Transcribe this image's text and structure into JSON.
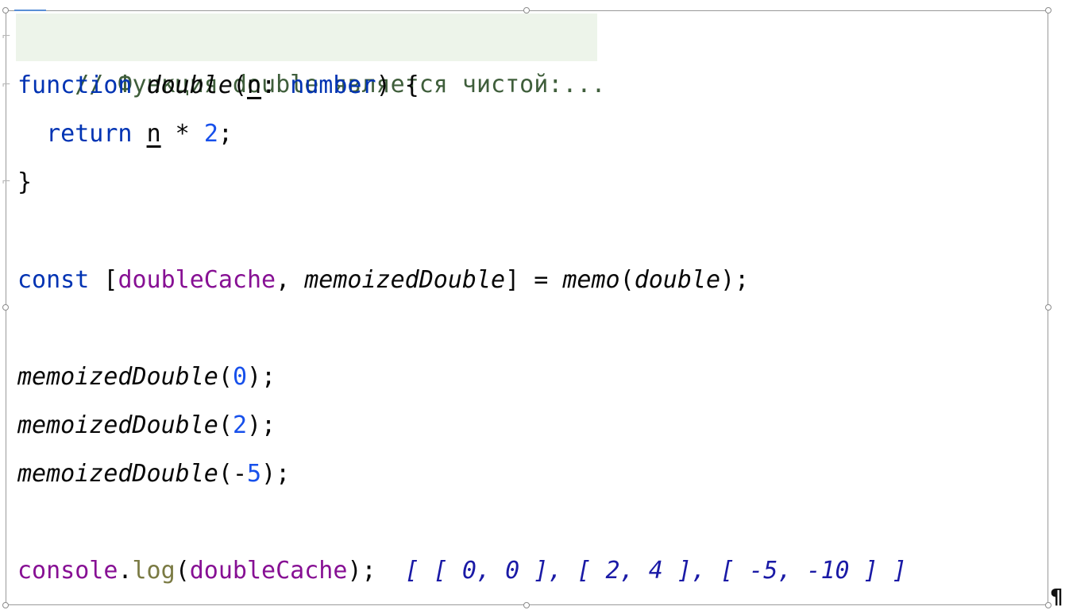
{
  "code": {
    "comment": "// Функция double является чистой:...",
    "fn_keyword": "function",
    "fn_name": "double",
    "paren_open": "(",
    "param": "n",
    "colon": ": ",
    "param_type": "number",
    "paren_close_brace": ") {",
    "return_keyword": "return",
    "return_param": "n",
    "multiply": " * ",
    "multiplier": "2",
    "semicolon": ";",
    "close_brace": "}",
    "const_keyword": "const",
    "bracket_open": " [",
    "cache_var": "doubleCache",
    "comma": ", ",
    "memoized_name": "memoizedDouble",
    "bracket_close_assign": "] = ",
    "memo_fn": "memo",
    "memo_paren_open": "(",
    "memo_arg": "double",
    "memo_paren_close": ");",
    "calls": [
      {
        "name": "memoizedDouble",
        "open": "(",
        "prefix": "",
        "arg": "0",
        "close": ");"
      },
      {
        "name": "memoizedDouble",
        "open": "(",
        "prefix": "",
        "arg": "2",
        "close": ");"
      },
      {
        "name": "memoizedDouble",
        "open": "(",
        "prefix": "-",
        "arg": "5",
        "close": ");"
      }
    ],
    "console_obj": "console",
    "dot": ".",
    "log_method": "log",
    "log_paren_open": "(",
    "log_arg": "doubleCache",
    "log_paren_close": ");",
    "result_comment": "[ [ 0, 0 ], [ 2, 4 ], [ -5, -10 ] ]"
  },
  "pilcrow": "¶",
  "fold_marker_top": "⌐",
  "fold_marker_bottom": "⌐",
  "colors": {
    "keyword": "#0033b3",
    "number": "#1750eb",
    "variable": "#871094",
    "method": "#7a7a43",
    "folded_background": "#edf4ea",
    "result": "#1a1aa6"
  }
}
